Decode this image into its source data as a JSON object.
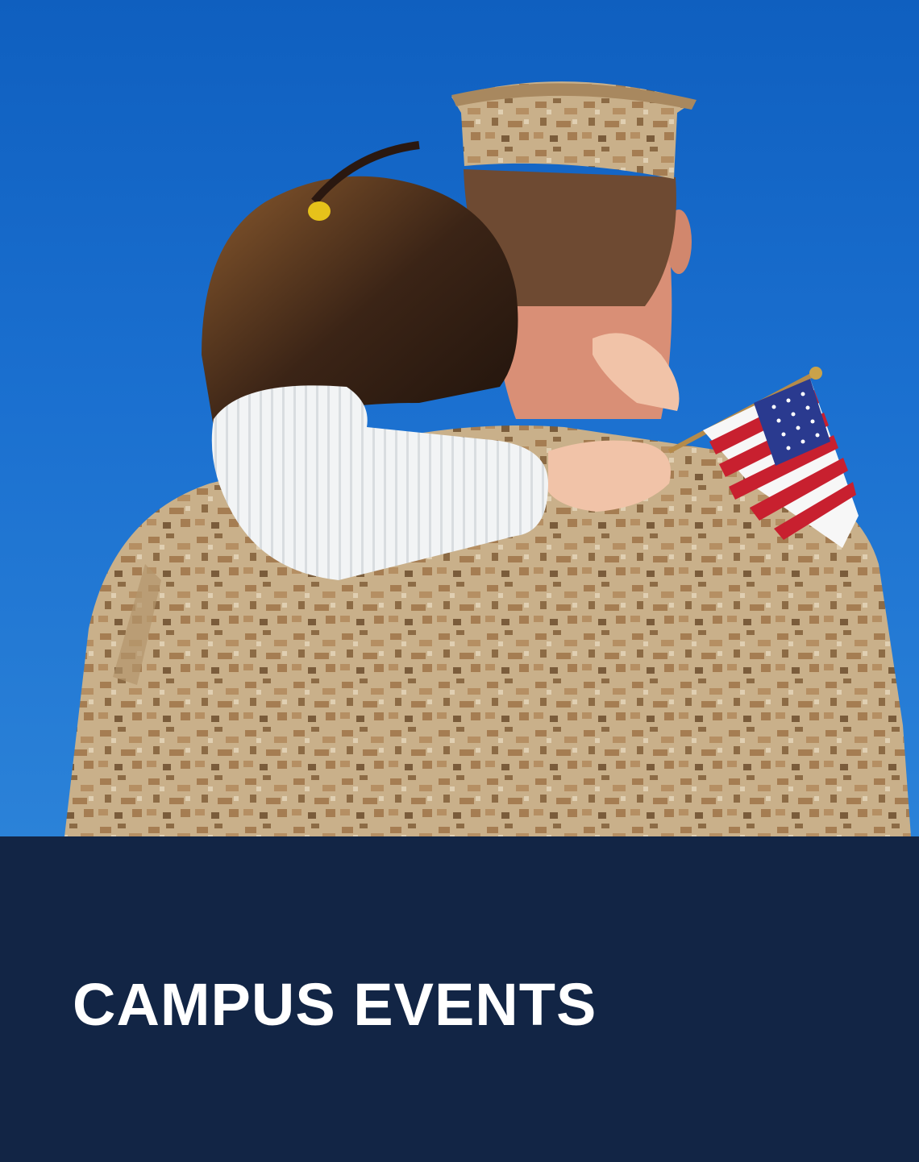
{
  "card": {
    "title": "CAMPUS EVENTS"
  },
  "colors": {
    "caption_background": "#122545",
    "title_text": "#ffffff",
    "sky": "#1a6fcf"
  }
}
